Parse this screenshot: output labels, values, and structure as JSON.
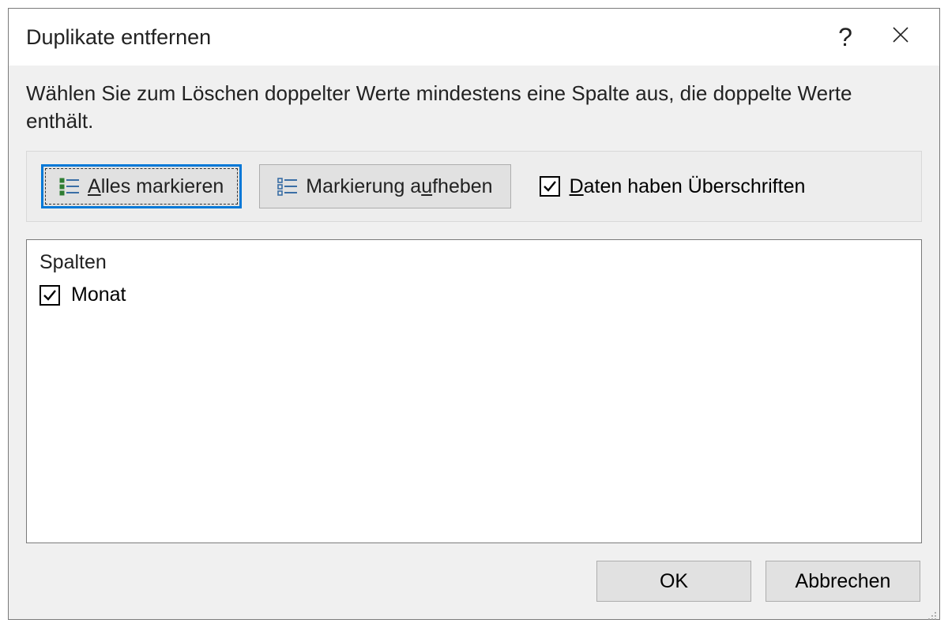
{
  "dialog": {
    "title": "Duplikate entfernen",
    "instructions": "Wählen Sie zum Löschen doppelter Werte mindestens eine Spalte aus, die doppelte Werte enthält."
  },
  "toolbar": {
    "select_all": {
      "pre": "",
      "mn": "A",
      "post": "lles markieren"
    },
    "unselect_all": {
      "pre": "Markierung a",
      "mn": "u",
      "post": "fheben"
    },
    "headers_checkbox": {
      "pre": "",
      "mn": "D",
      "post": "aten haben Überschriften",
      "checked": true
    }
  },
  "list": {
    "header": "Spalten",
    "items": [
      {
        "label": "Monat",
        "checked": true
      }
    ]
  },
  "footer": {
    "ok": "OK",
    "cancel": "Abbrechen"
  },
  "icons": {
    "help": "?",
    "close": "×"
  }
}
